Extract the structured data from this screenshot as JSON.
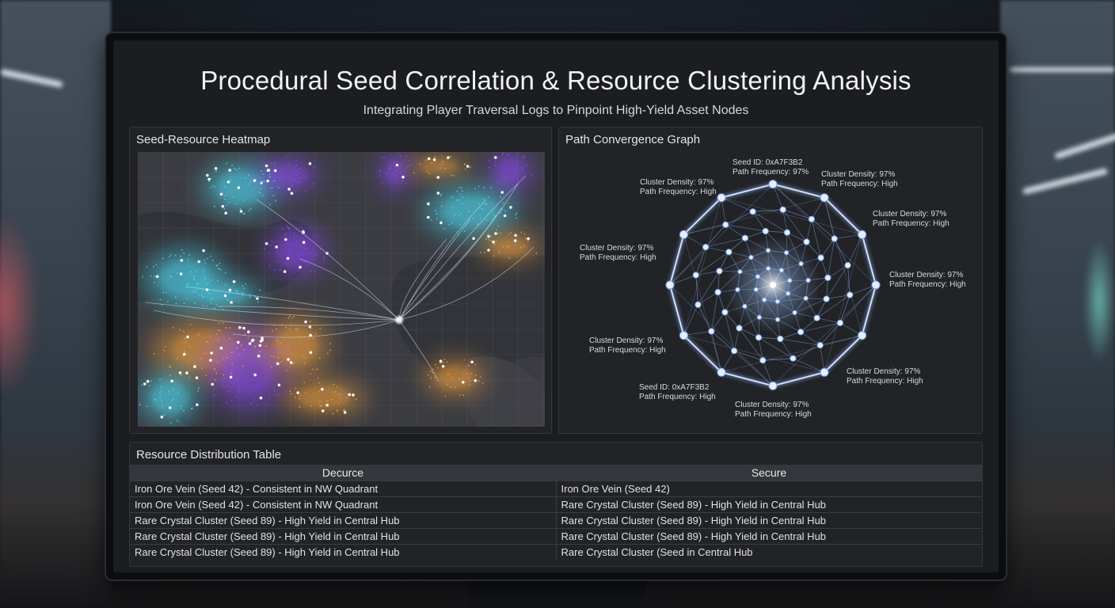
{
  "header": {
    "title": "Procedural Seed Correlation & Resource Clustering Analysis",
    "subtitle": "Integrating Player Traversal Logs to Pinpoint High-Yield Asset Nodes"
  },
  "heatmap_panel": {
    "title": "Seed-Resource Heatmap"
  },
  "graph_panel": {
    "title": "Path Convergence Graph",
    "labels": [
      {
        "line1": "Seed ID: 0xA7F3B2",
        "line2": "Path Frequency: 97%"
      },
      {
        "line1": "Cluster Density: 97%",
        "line2": "Path Frequency: High"
      },
      {
        "line1": "Cluster Density: 97%",
        "line2": "Path Frequency: High"
      },
      {
        "line1": "Cluster Density: 97%",
        "line2": "Path Frequency: High"
      },
      {
        "line1": "Cluster Density: 97%",
        "line2": "Path Frequency: High"
      },
      {
        "line1": "Cluster Density: 97%",
        "line2": "Path Frequency: High"
      },
      {
        "line1": "Cluster Density: 97%",
        "line2": "Path Frequency: High"
      },
      {
        "line1": "Cluster Density: 97%",
        "line2": "Path Frequency: High"
      },
      {
        "line1": "Seed ID: 0xA7F3B2",
        "line2": "Path Frequency: High"
      },
      {
        "line1": "Cluster Density: 97%",
        "line2": "Path Frequency: High"
      }
    ]
  },
  "table_panel": {
    "title": "Resource Distribution Table",
    "columns": [
      "Decurce",
      "Secure"
    ],
    "rows": [
      [
        "Iron Ore Vein (Seed 42) - Consistent in NW Quadrant",
        "Iron Ore Vein (Seed 42)"
      ],
      [
        "Iron Ore Vein (Seed 42) - Consistent in NW Quadrant",
        "Rare Crystal Cluster (Seed 89) - High Yield in Central Hub"
      ],
      [
        "Rare Crystal Cluster (Seed 89) - High Yield in Central Hub",
        "Rare Crystal Cluster (Seed 89) - High Yield in Central Hub"
      ],
      [
        "Rare Crystal Cluster (Seed 89) - High Yield in Central Hub",
        "Rare Crystal Cluster (Seed 89) - High Yield in Central Hub"
      ],
      [
        "Rare Crystal Cluster (Seed 89) - High Yield in Central Hub",
        "Rare Crystal Cluster (Seed in Central Hub"
      ]
    ]
  },
  "colors": {
    "cyan": "#4fd8f0",
    "purple": "#8a4cf0",
    "orange": "#f0a040",
    "node": "#e6efff",
    "edge": "#8fb4f0"
  }
}
